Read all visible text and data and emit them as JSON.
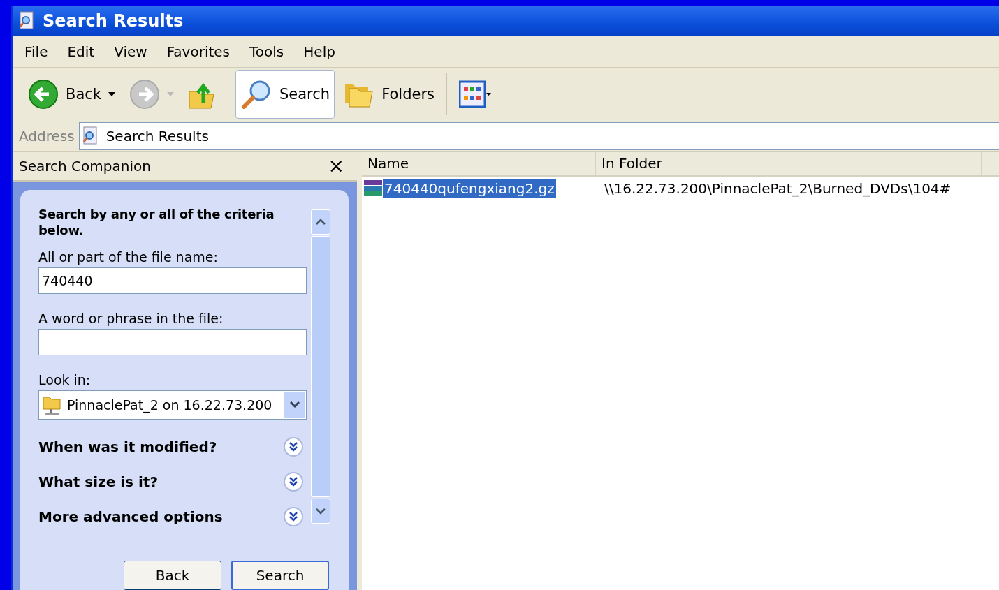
{
  "window": {
    "title": "Search Results"
  },
  "menu": [
    "File",
    "Edit",
    "View",
    "Favorites",
    "Tools",
    "Help"
  ],
  "toolbar": [
    {
      "kind": "back",
      "label": "Back",
      "disabled": false
    },
    {
      "kind": "forward",
      "disabled": true
    },
    {
      "kind": "up"
    },
    {
      "kind": "search",
      "label": "Search",
      "selected": true
    },
    {
      "kind": "folders",
      "label": "Folders",
      "selected": false
    },
    {
      "kind": "views"
    }
  ],
  "address": {
    "label": "Address",
    "value": "Search Results"
  },
  "companion": {
    "title": "Search Companion",
    "close": "×",
    "heading": "Search by any or all of the criteria below.",
    "fields": [
      {
        "kind": "text",
        "label": "All or part of the file name:",
        "value": "740440"
      },
      {
        "kind": "text",
        "label": "A word or phrase in the file:"
      },
      {
        "kind": "select",
        "label": "Look in:",
        "value": "PinnaclePat_2 on 16.22.73.200"
      }
    ],
    "sections": [
      {
        "label": "When was it modified?",
        "expanded": false
      },
      {
        "label": "What size is it?",
        "expanded": false
      },
      {
        "label": "More advanced options",
        "expanded": false
      }
    ],
    "buttons": [
      {
        "label": "Back",
        "default": false
      },
      {
        "label": "Search",
        "default": true
      }
    ]
  },
  "table": {
    "columns": [
      "Name",
      "In Folder"
    ],
    "rows": [
      {
        "name": "740440qufengxiang2.gz",
        "folder": "\\\\16.22.73.200\\PinnaclePat_2\\Burned_DVDs\\104#",
        "selected": true
      }
    ]
  }
}
